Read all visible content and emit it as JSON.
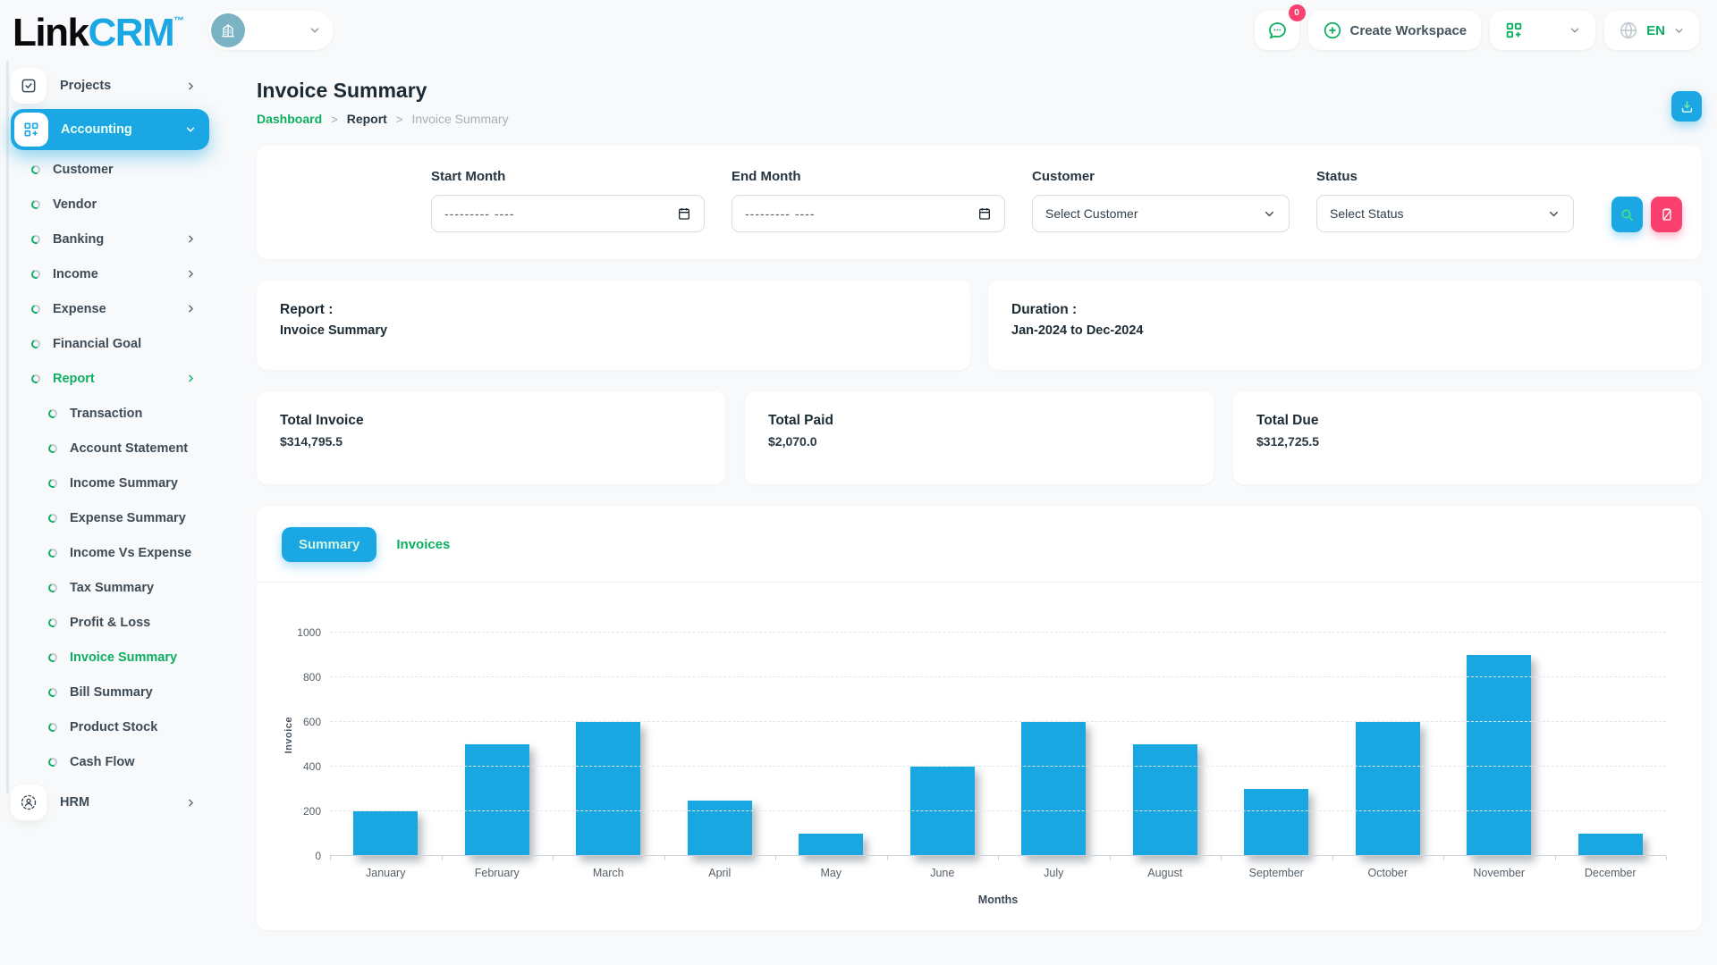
{
  "brand": {
    "name_black": "Link",
    "name_blue": "CRM",
    "tm": "™"
  },
  "header": {
    "messages_badge": "0",
    "create_workspace_label": "Create Workspace",
    "language": "EN"
  },
  "sidebar": {
    "items": [
      {
        "label": "Projects",
        "type": "top",
        "icon": "checkbox-icon",
        "chevron": "right"
      },
      {
        "label": "Accounting",
        "type": "top",
        "icon": "grid-icon",
        "chevron": "down",
        "active": true
      },
      {
        "label": "Customer",
        "type": "sub",
        "level": 1
      },
      {
        "label": "Vendor",
        "type": "sub",
        "level": 1
      },
      {
        "label": "Banking",
        "type": "sub",
        "level": 1,
        "chevron": "right"
      },
      {
        "label": "Income",
        "type": "sub",
        "level": 1,
        "chevron": "right"
      },
      {
        "label": "Expense",
        "type": "sub",
        "level": 1,
        "chevron": "right"
      },
      {
        "label": "Financial Goal",
        "type": "sub",
        "level": 1
      },
      {
        "label": "Report",
        "type": "sub",
        "level": 1,
        "chevron": "right",
        "active": true
      },
      {
        "label": "Transaction",
        "type": "sub",
        "level": 2
      },
      {
        "label": "Account Statement",
        "type": "sub",
        "level": 2
      },
      {
        "label": "Income Summary",
        "type": "sub",
        "level": 2
      },
      {
        "label": "Expense Summary",
        "type": "sub",
        "level": 2
      },
      {
        "label": "Income Vs Expense",
        "type": "sub",
        "level": 2
      },
      {
        "label": "Tax Summary",
        "type": "sub",
        "level": 2
      },
      {
        "label": "Profit & Loss",
        "type": "sub",
        "level": 2
      },
      {
        "label": "Invoice Summary",
        "type": "sub",
        "level": 2,
        "active": true
      },
      {
        "label": "Bill Summary",
        "type": "sub",
        "level": 2
      },
      {
        "label": "Product Stock",
        "type": "sub",
        "level": 2
      },
      {
        "label": "Cash Flow",
        "type": "sub",
        "level": 2
      },
      {
        "label": "HRM",
        "type": "top",
        "icon": "person-icon",
        "chevron": "right"
      }
    ]
  },
  "page": {
    "title": "Invoice Summary",
    "breadcrumb": [
      "Dashboard",
      "Report",
      "Invoice Summary"
    ],
    "breadcrumb_sep": ">"
  },
  "filters": {
    "start_month_label": "Start Month",
    "start_month_placeholder": "--------- ----",
    "end_month_label": "End Month",
    "end_month_placeholder": "--------- ----",
    "customer_label": "Customer",
    "customer_value": "Select Customer",
    "status_label": "Status",
    "status_value": "Select Status"
  },
  "summary": {
    "report_label": "Report :",
    "report_value": "Invoice Summary",
    "duration_label": "Duration :",
    "duration_value": "Jan-2024 to Dec-2024",
    "totals": [
      {
        "label": "Total Invoice",
        "value": "$314,795.5"
      },
      {
        "label": "Total Paid",
        "value": "$2,070.0"
      },
      {
        "label": "Total Due",
        "value": "$312,725.5"
      }
    ]
  },
  "tabs": [
    {
      "label": "Summary",
      "active": true
    },
    {
      "label": "Invoices",
      "active": false
    }
  ],
  "chart_data": {
    "type": "bar",
    "categories": [
      "January",
      "February",
      "March",
      "April",
      "May",
      "June",
      "July",
      "August",
      "September",
      "October",
      "November",
      "December"
    ],
    "values": [
      200,
      500,
      600,
      250,
      100,
      400,
      600,
      500,
      300,
      600,
      900,
      100
    ],
    "title": "",
    "xlabel": "Months",
    "ylabel": "Invoice",
    "ylim": [
      0,
      1000
    ],
    "yticks": [
      0,
      200,
      400,
      600,
      800,
      1000
    ],
    "bar_color": "#19a7e2",
    "grid": "horizontal-dashed",
    "legend": "none"
  },
  "colors": {
    "brand_blue": "#1aa7e3",
    "accent_green": "#0caf60",
    "accent_pink": "#f9406e"
  }
}
